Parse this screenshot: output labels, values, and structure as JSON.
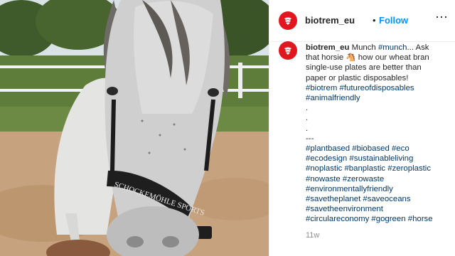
{
  "post": {
    "username": "biotrem_eu",
    "separator": "•",
    "follow_label": "Follow",
    "more_icon": "⋯",
    "time_ago": "11w"
  },
  "caption": {
    "username": "biotrem_eu",
    "line1_text": "Munch",
    "line1_tag": "#munch",
    "line1_rest": "... Ask",
    "line2": "that horsie 🐴 how our wheat bran",
    "line3": "single-use plates are better than",
    "line4": "paper or plastic disposables!",
    "tags1": "#biotrem #futureofdisposables",
    "tags2": "#animalfriendly",
    "dot1": ".",
    "dot2": ".",
    "dot3": ".",
    "dashes": "---",
    "tags3": "#plantbased #biobased #eco",
    "tags4": "#ecodesign #sustainableliving",
    "tags5": "#noplastic #banplastic #zeroplastic",
    "tags6": "#nowaste #zerowaste",
    "tags7": "#environmentallyfriendly",
    "tags8": "#savetheplanet #saveoceans",
    "tags9": "#savetheenvironment",
    "tags10": "#circulareconomy #gogreen #horse"
  },
  "photo": {
    "halter_text": "SCHOCKEMÖHLE SPORTS"
  },
  "colors": {
    "brand_red": "#e2161f",
    "follow_blue": "#0095f6",
    "hashtag_blue": "#00376b",
    "muted_gray": "#8e8e8e"
  }
}
